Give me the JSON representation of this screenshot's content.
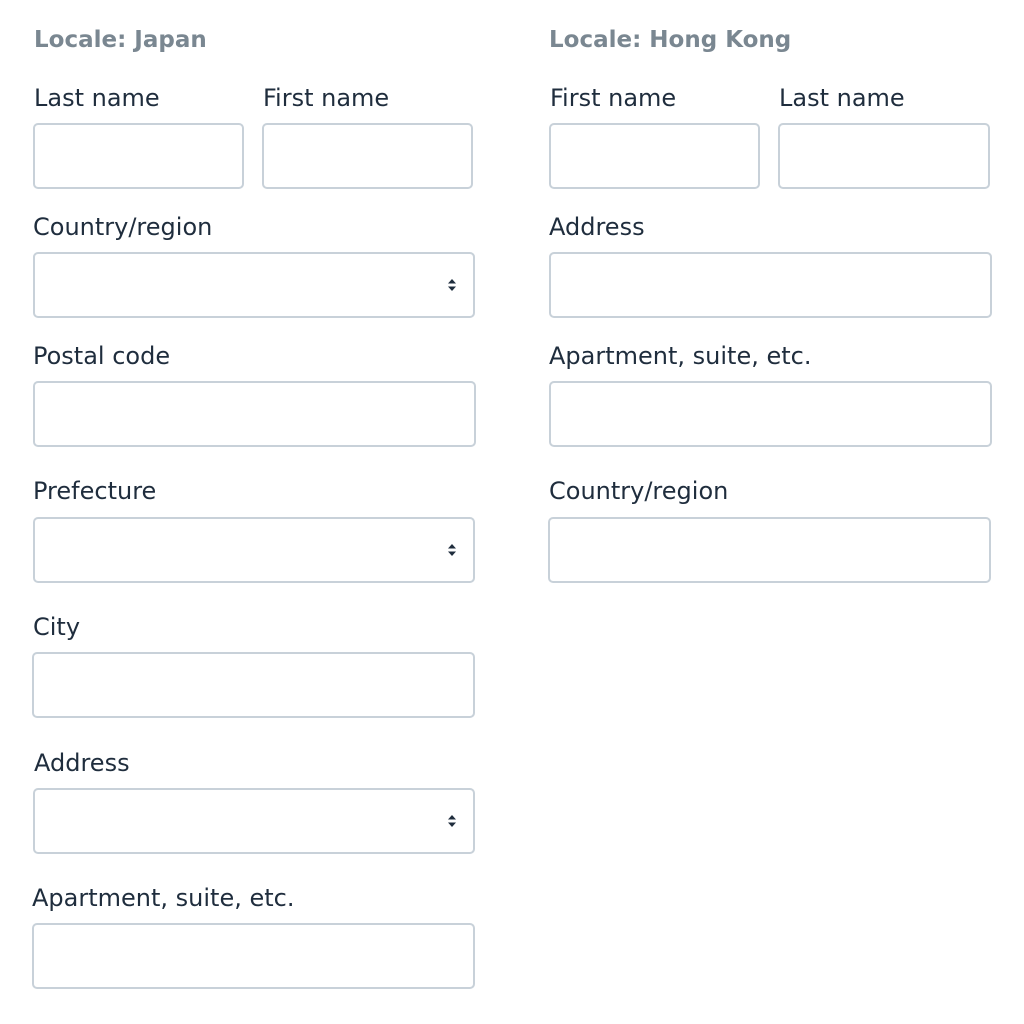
{
  "japan": {
    "heading": "Locale: Japan",
    "last_name_label": "Last name",
    "first_name_label": "First name",
    "country_label": "Country/region",
    "postal_label": "Postal code",
    "prefecture_label": "Prefecture",
    "city_label": "City",
    "address_label": "Address",
    "apartment_label": "Apartment, suite, etc."
  },
  "hong_kong": {
    "heading": "Locale: Hong Kong",
    "first_name_label": "First name",
    "last_name_label": "Last name",
    "address_label": "Address",
    "apartment_label": "Apartment, suite, etc.",
    "country_label": "Country/region"
  },
  "icons": {
    "select": "chevron-up-down-icon"
  },
  "colors": {
    "heading": "#7a8791",
    "label": "#1f2d3d",
    "border": "#c8d1d9"
  }
}
